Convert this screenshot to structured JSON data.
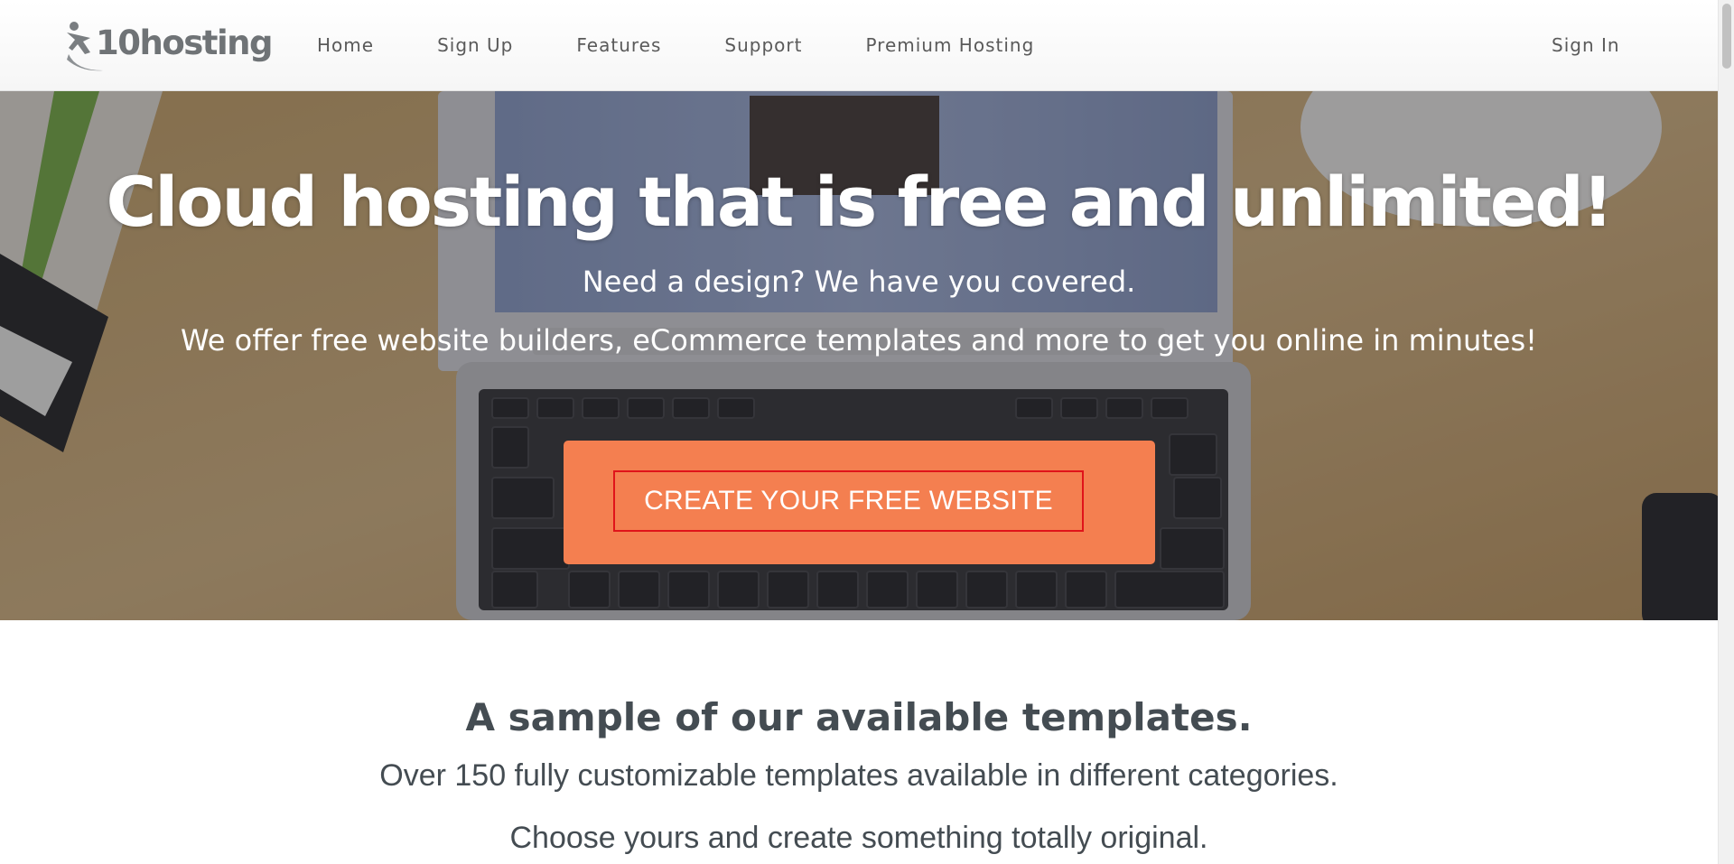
{
  "brand": {
    "logo_text": "10hosting",
    "logo_icon": "person-swoosh-icon"
  },
  "nav": {
    "items": [
      {
        "label": "Home"
      },
      {
        "label": "Sign Up"
      },
      {
        "label": "Features"
      },
      {
        "label": "Support"
      },
      {
        "label": "Premium Hosting"
      }
    ],
    "sign_in": "Sign In"
  },
  "hero": {
    "title": "Cloud hosting that is free and unlimited!",
    "subtitle1": "Need a design? We have you covered.",
    "subtitle2": "We offer free website builders, eCommerce templates and more to get you online in minutes!",
    "cta_label": "CREATE YOUR FREE WEBSITE",
    "background_image": "laptop-on-desk-photo"
  },
  "templates": {
    "title": "A sample of our available templates.",
    "subtitle1": "Over 150 fully customizable templates available in different categories.",
    "subtitle2": "Choose yours and create something totally original."
  },
  "colors": {
    "cta_background": "#f47f50",
    "cta_border": "#e0141a",
    "heading_text": "#444c52",
    "nav_text": "#5a5a5a"
  }
}
